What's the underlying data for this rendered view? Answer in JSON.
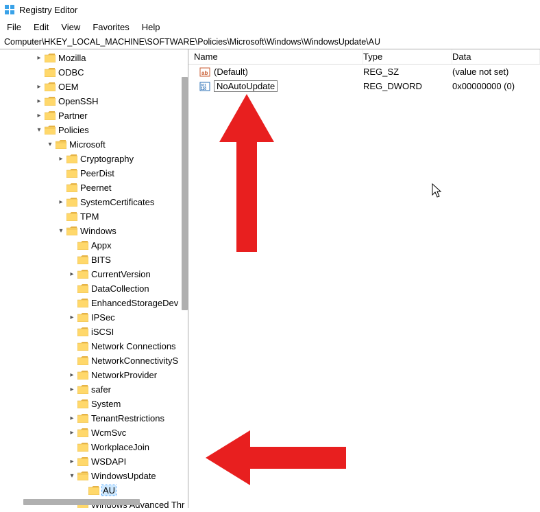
{
  "window": {
    "title": "Registry Editor"
  },
  "menu": [
    "File",
    "Edit",
    "View",
    "Favorites",
    "Help"
  ],
  "address": "Computer\\HKEY_LOCAL_MACHINE\\SOFTWARE\\Policies\\Microsoft\\Windows\\WindowsUpdate\\AU",
  "tree": [
    {
      "depth": 2,
      "exp": ">",
      "label": "Mozilla"
    },
    {
      "depth": 2,
      "exp": "",
      "label": "ODBC"
    },
    {
      "depth": 2,
      "exp": ">",
      "label": "OEM"
    },
    {
      "depth": 2,
      "exp": ">",
      "label": "OpenSSH"
    },
    {
      "depth": 2,
      "exp": ">",
      "label": "Partner"
    },
    {
      "depth": 2,
      "exp": "v",
      "label": "Policies"
    },
    {
      "depth": 3,
      "exp": "v",
      "label": "Microsoft"
    },
    {
      "depth": 4,
      "exp": ">",
      "label": "Cryptography"
    },
    {
      "depth": 4,
      "exp": "",
      "label": "PeerDist"
    },
    {
      "depth": 4,
      "exp": "",
      "label": "Peernet"
    },
    {
      "depth": 4,
      "exp": ">",
      "label": "SystemCertificates"
    },
    {
      "depth": 4,
      "exp": "",
      "label": "TPM"
    },
    {
      "depth": 4,
      "exp": "v",
      "label": "Windows"
    },
    {
      "depth": 5,
      "exp": "",
      "label": "Appx"
    },
    {
      "depth": 5,
      "exp": "",
      "label": "BITS"
    },
    {
      "depth": 5,
      "exp": ">",
      "label": "CurrentVersion"
    },
    {
      "depth": 5,
      "exp": "",
      "label": "DataCollection"
    },
    {
      "depth": 5,
      "exp": "",
      "label": "EnhancedStorageDev"
    },
    {
      "depth": 5,
      "exp": ">",
      "label": "IPSec"
    },
    {
      "depth": 5,
      "exp": "",
      "label": "iSCSI"
    },
    {
      "depth": 5,
      "exp": "",
      "label": "Network Connections"
    },
    {
      "depth": 5,
      "exp": "",
      "label": "NetworkConnectivityS"
    },
    {
      "depth": 5,
      "exp": ">",
      "label": "NetworkProvider"
    },
    {
      "depth": 5,
      "exp": ">",
      "label": "safer"
    },
    {
      "depth": 5,
      "exp": "",
      "label": "System"
    },
    {
      "depth": 5,
      "exp": ">",
      "label": "TenantRestrictions"
    },
    {
      "depth": 5,
      "exp": ">",
      "label": "WcmSvc"
    },
    {
      "depth": 5,
      "exp": "",
      "label": "WorkplaceJoin"
    },
    {
      "depth": 5,
      "exp": ">",
      "label": "WSDAPI"
    },
    {
      "depth": 5,
      "exp": "v",
      "label": "WindowsUpdate"
    },
    {
      "depth": 6,
      "exp": "",
      "label": "AU",
      "selected": true
    },
    {
      "depth": 5,
      "exp": "",
      "label": "Windows Advanced Thr"
    }
  ],
  "list": {
    "headers": {
      "name": "Name",
      "type": "Type",
      "data": "Data"
    },
    "rows": [
      {
        "iconKind": "sz",
        "name": "(Default)",
        "type": "REG_SZ",
        "data": "(value not set)",
        "editing": false
      },
      {
        "iconKind": "dword",
        "name": "NoAutoUpdate",
        "type": "REG_DWORD",
        "data": "0x00000000 (0)",
        "editing": true
      }
    ]
  },
  "colors": {
    "arrow": "#e81f1f"
  }
}
